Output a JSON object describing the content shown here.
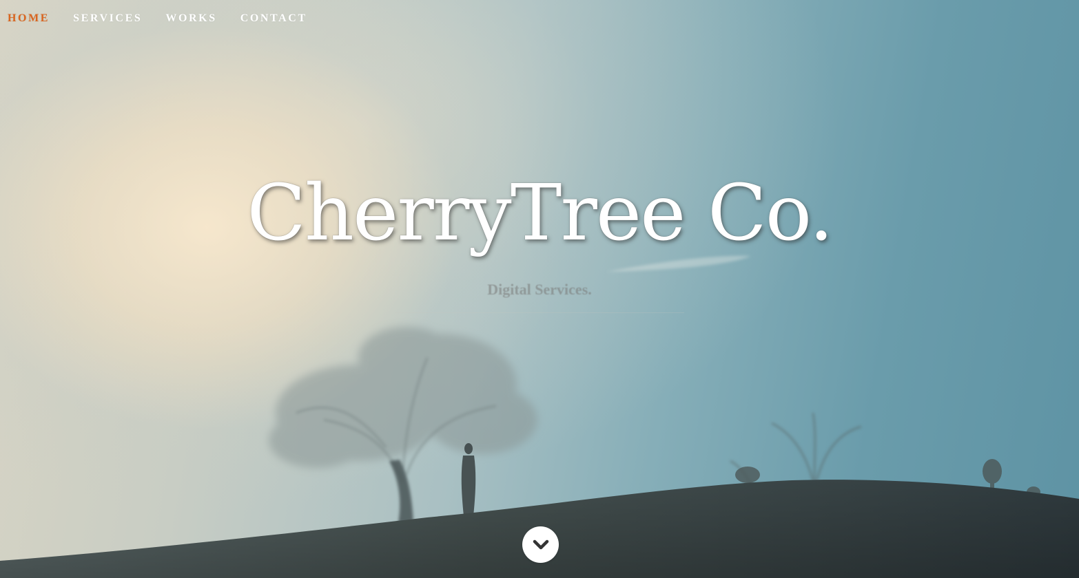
{
  "nav": {
    "items": [
      {
        "label": "HOME",
        "active": true
      },
      {
        "label": "SERVICES",
        "active": false
      },
      {
        "label": "WORKS",
        "active": false
      },
      {
        "label": "CONTACT",
        "active": false
      }
    ]
  },
  "hero": {
    "title": "CherryTree Co.",
    "tagline": "Digital Services.",
    "scroll_icon": "chevron-down-icon"
  },
  "colors": {
    "nav_active": "#d9651f",
    "nav_text": "#ffffff",
    "title_text": "#ffffff",
    "scroll_button_bg": "#ffffff",
    "scroll_icon": "#333333"
  }
}
